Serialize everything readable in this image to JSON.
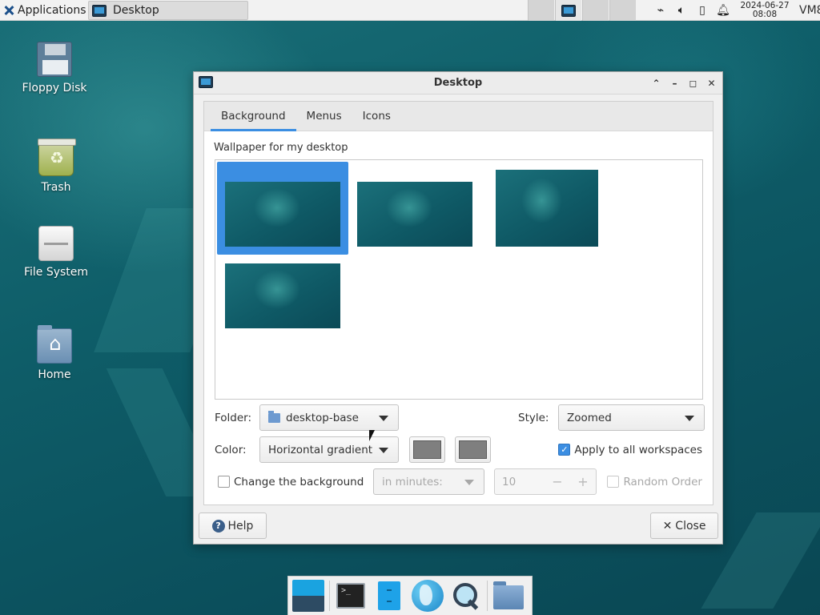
{
  "top_panel": {
    "applications_label": "Applications",
    "taskbar_window_title": "Desktop",
    "clock_date": "2024-06-27",
    "clock_time": "08:08",
    "host_label": "VM8",
    "tray_icons": [
      "network-icon",
      "volume-icon",
      "battery-icon",
      "notification-bell-icon"
    ]
  },
  "desktop_icons": [
    {
      "label": "Floppy Disk",
      "icon": "floppy-disk-icon"
    },
    {
      "label": "Trash",
      "icon": "trash-icon"
    },
    {
      "label": "File System",
      "icon": "drive-icon"
    },
    {
      "label": "Home",
      "icon": "home-folder-icon"
    }
  ],
  "dialog": {
    "title": "Desktop",
    "tabs": [
      "Background",
      "Menus",
      "Icons"
    ],
    "active_tab": "Background",
    "wallpaper_label": "Wallpaper for my desktop",
    "wallpaper_thumbnails": 4,
    "selected_thumbnail": 1,
    "folder_label": "Folder:",
    "folder_value": "desktop-base",
    "style_label": "Style:",
    "style_value": "Zoomed",
    "color_label": "Color:",
    "color_value": "Horizontal gradient",
    "color_swatch_1": "#7f7f7f",
    "color_swatch_2": "#7f7f7f",
    "apply_all_label": "Apply to all workspaces",
    "apply_all_checked": true,
    "change_bg_label": "Change the background",
    "change_bg_checked": false,
    "interval_unit": "in minutes:",
    "interval_value": "10",
    "random_order_label": "Random Order",
    "random_order_checked": false,
    "help_label": "Help",
    "close_label": "Close"
  },
  "colors": {
    "accent": "#3b8ee2",
    "desktop_bg": "#0f5a66"
  },
  "dock_items": [
    "show-desktop-icon",
    "terminal-icon",
    "file-manager-icon",
    "web-browser-icon",
    "app-finder-icon",
    "folder-icon"
  ]
}
